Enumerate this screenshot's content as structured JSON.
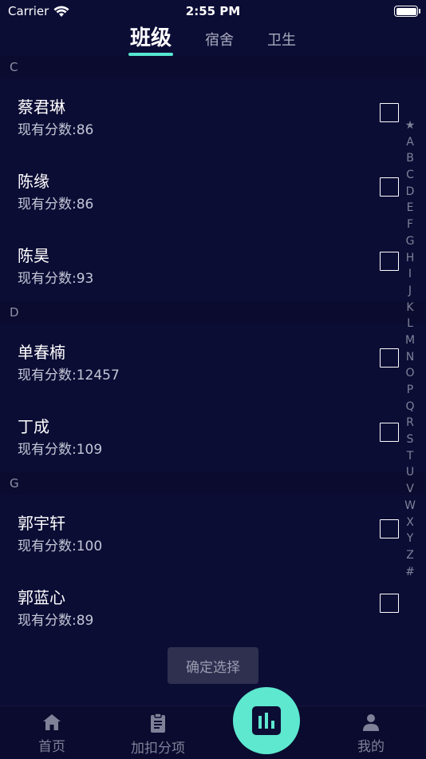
{
  "status_bar": {
    "carrier": "Carrier",
    "time": "2:55 PM"
  },
  "tabs": [
    {
      "label": "班级",
      "active": true
    },
    {
      "label": "宿舍",
      "active": false
    },
    {
      "label": "卫生",
      "active": false
    }
  ],
  "sections": [
    {
      "letter": "C",
      "students": [
        {
          "name": "蔡君琳",
          "score": "现有分数:86"
        },
        {
          "name": "陈缘",
          "score": "现有分数:86"
        },
        {
          "name": "陈昊",
          "score": "现有分数:93"
        }
      ]
    },
    {
      "letter": "D",
      "students": [
        {
          "name": "单春楠",
          "score": "现有分数:12457"
        },
        {
          "name": "丁成",
          "score": "现有分数:109"
        }
      ]
    },
    {
      "letter": "G",
      "students": [
        {
          "name": "郭宇轩",
          "score": "现有分数:100"
        },
        {
          "name": "郭蓝心",
          "score": "现有分数:89"
        }
      ]
    }
  ],
  "index_letters": [
    "★",
    "A",
    "B",
    "C",
    "D",
    "E",
    "F",
    "G",
    "H",
    "I",
    "J",
    "K",
    "L",
    "M",
    "N",
    "O",
    "P",
    "Q",
    "R",
    "S",
    "T",
    "U",
    "V",
    "W",
    "X",
    "Y",
    "Z",
    "#"
  ],
  "confirm_label": "确定选择",
  "bottom_nav": {
    "home": "首页",
    "add": "加扣分项",
    "me": "我的"
  },
  "colors": {
    "accent": "#56e7cf",
    "background": "#0c0d35"
  }
}
